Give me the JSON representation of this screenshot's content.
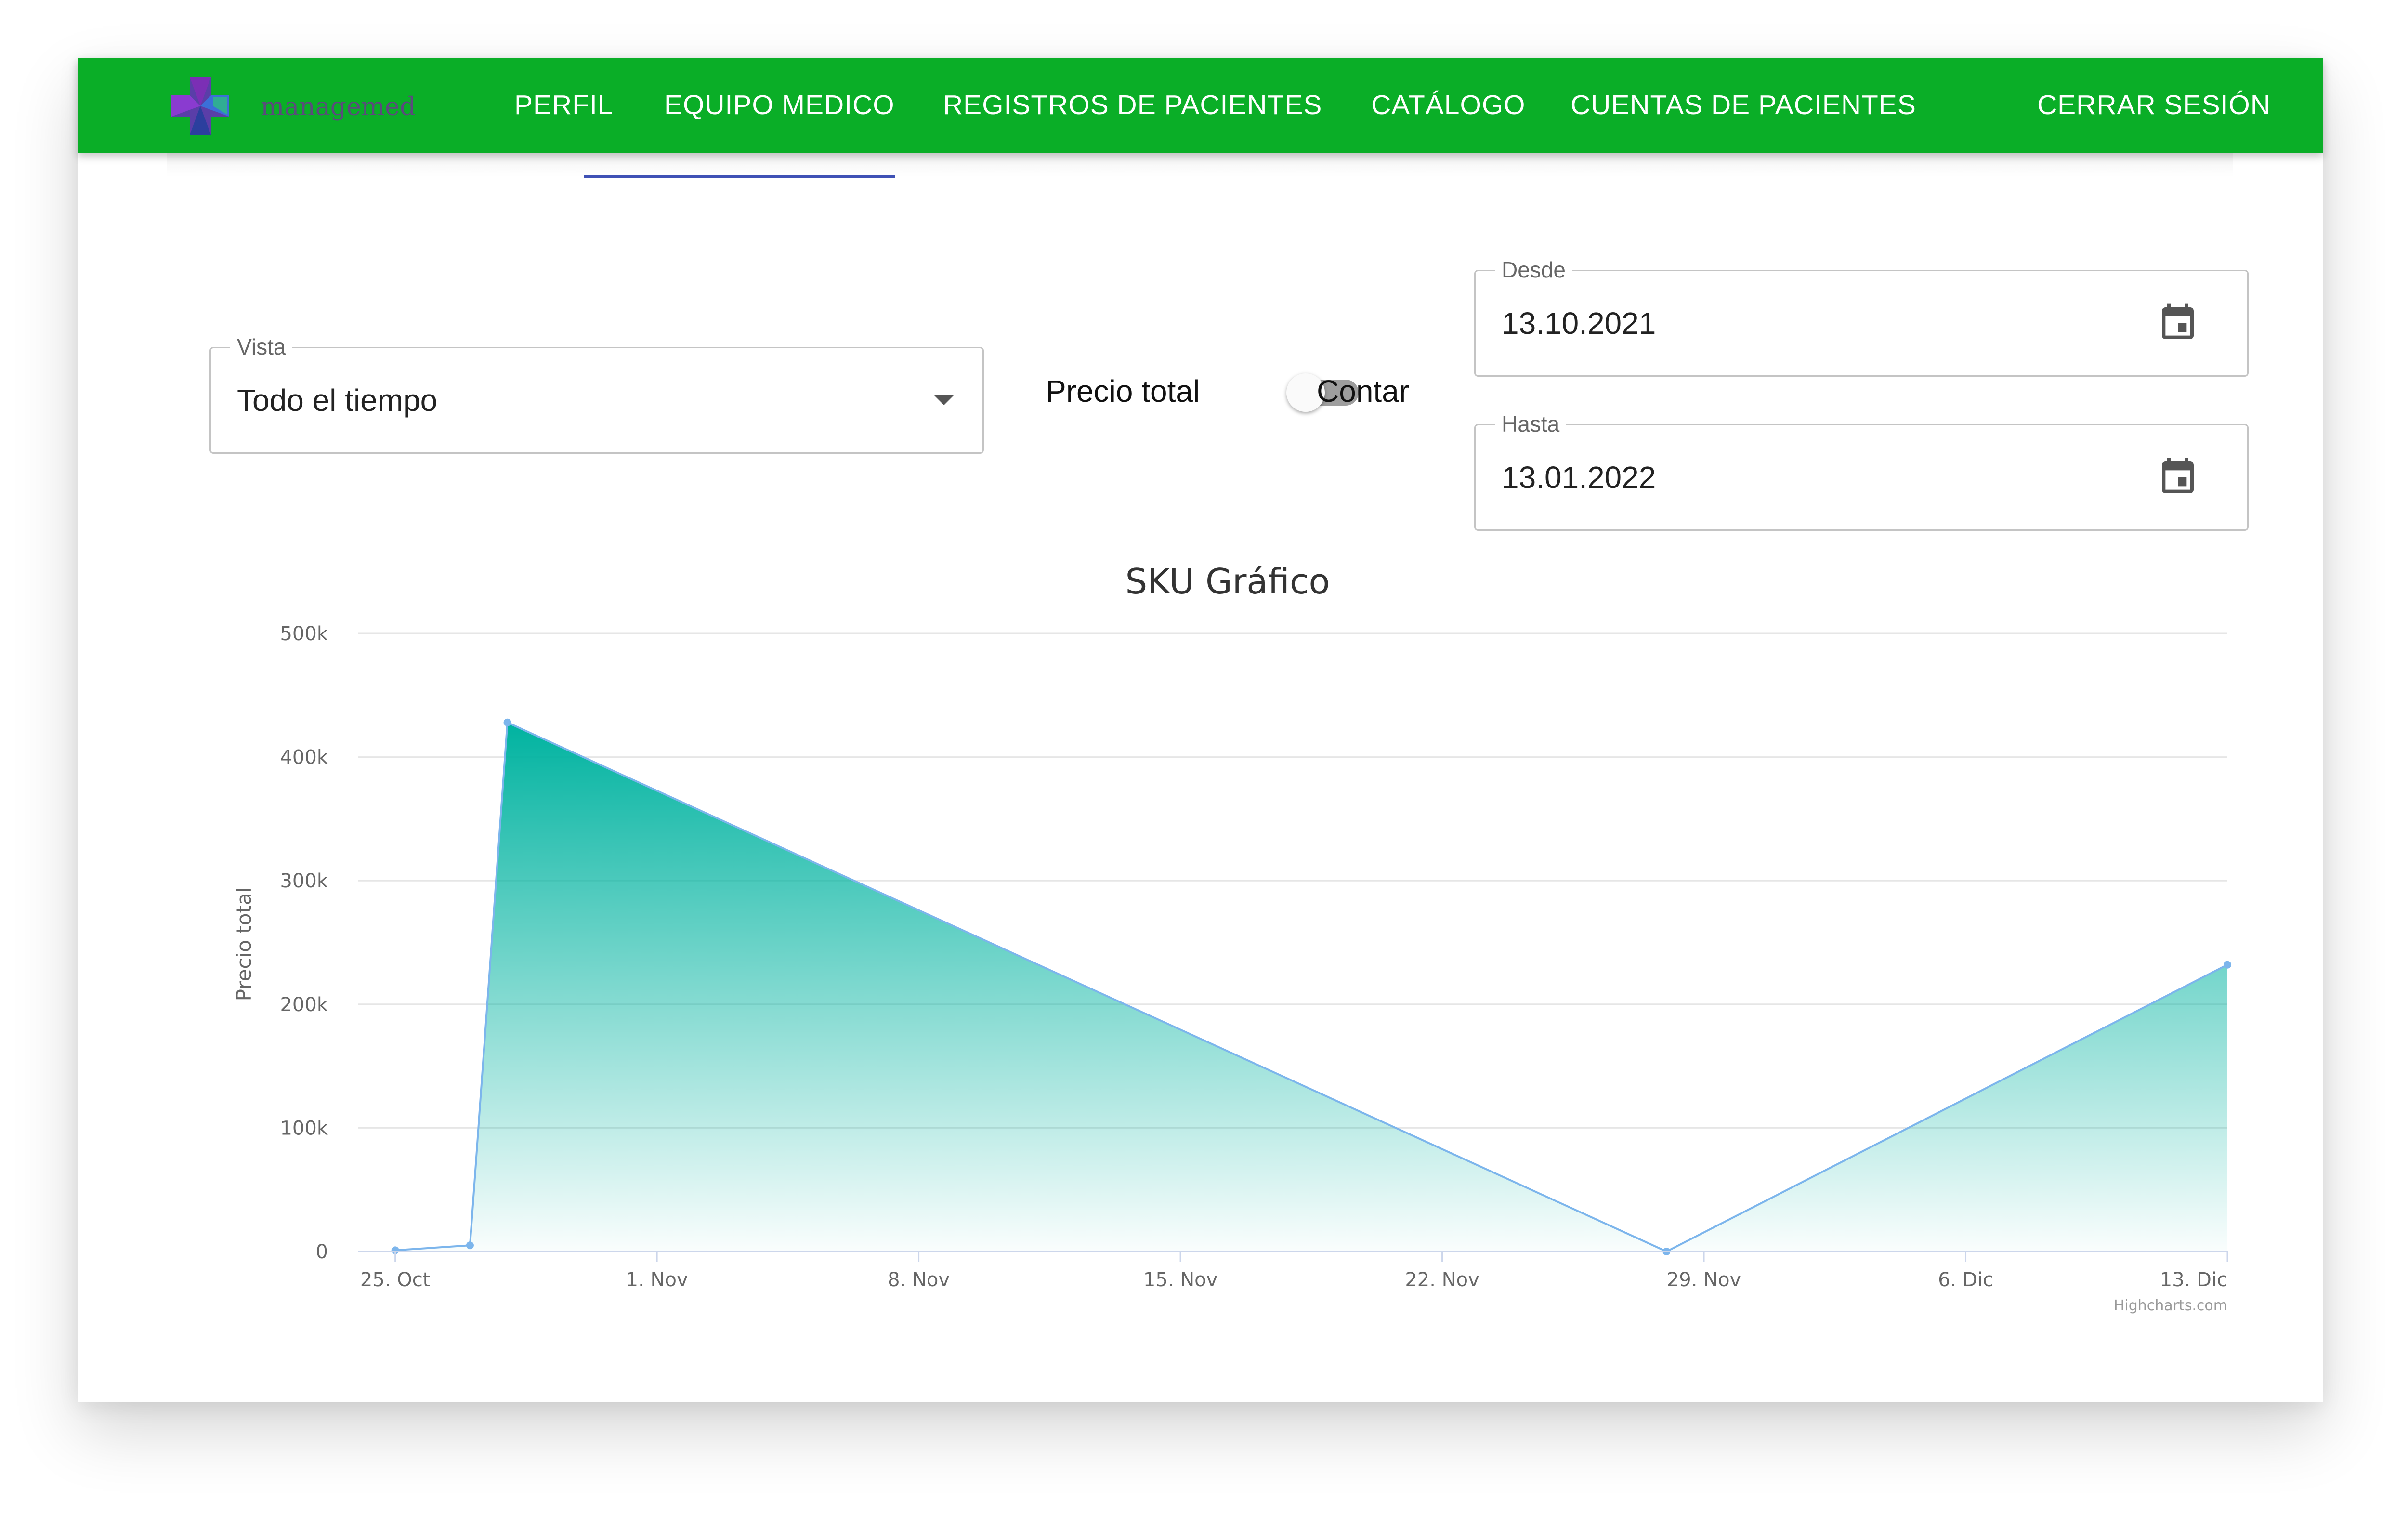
{
  "navbar": {
    "brand": "managemed",
    "items": [
      {
        "label": "PERFIL"
      },
      {
        "label": "EQUIPO MEDICO"
      },
      {
        "label": "REGISTROS DE PACIENTES"
      },
      {
        "label": "CATÁLOGO"
      },
      {
        "label": "CUENTAS DE PACIENTES"
      }
    ],
    "logout": "CERRAR SESIÓN",
    "active_index": 1
  },
  "filters": {
    "view_label": "Vista",
    "view_value": "Todo el tiempo",
    "toggle_left": "Precio total",
    "toggle_right": "Contar",
    "from_label": "Desde",
    "from_value": "13.10.2021",
    "to_label": "Hasta",
    "to_value": "13.01.2022"
  },
  "colors": {
    "navbar": "#0aae27",
    "active_indicator": "#3f51b5",
    "area_top": "#00b3a0",
    "series_line": "#7cb5ec"
  },
  "icons": {
    "calendar": "calendar-icon",
    "dropdown": "arrow-drop-down-icon",
    "logo": "medical-cross-logo-icon"
  },
  "chart_data": {
    "type": "area",
    "title": "SKU Gráfico",
    "ylabel": "Precio total",
    "xlabel": "",
    "credits": "Highcharts.com",
    "x_range": [
      "2021-10-24",
      "2021-12-13"
    ],
    "ylim": [
      0,
      500000
    ],
    "y_ticks": [
      {
        "value": 0,
        "label": "0"
      },
      {
        "value": 100000,
        "label": "100k"
      },
      {
        "value": 200000,
        "label": "200k"
      },
      {
        "value": 300000,
        "label": "300k"
      },
      {
        "value": 400000,
        "label": "400k"
      },
      {
        "value": 500000,
        "label": "500k"
      }
    ],
    "x_ticks": [
      {
        "date": "2021-10-25",
        "label": "25. Oct"
      },
      {
        "date": "2021-11-01",
        "label": "1. Nov"
      },
      {
        "date": "2021-11-08",
        "label": "8. Nov"
      },
      {
        "date": "2021-11-15",
        "label": "15. Nov"
      },
      {
        "date": "2021-11-22",
        "label": "22. Nov"
      },
      {
        "date": "2021-11-29",
        "label": "29. Nov"
      },
      {
        "date": "2021-12-06",
        "label": "6. Dic"
      },
      {
        "date": "2021-12-13",
        "label": "13. Dic"
      }
    ],
    "grid": true,
    "legend": false,
    "points": [
      {
        "date": "2021-10-25",
        "value": 1000
      },
      {
        "date": "2021-10-27",
        "value": 5000
      },
      {
        "date": "2021-10-28",
        "value": 428000
      },
      {
        "date": "2021-11-28",
        "value": 0
      },
      {
        "date": "2021-12-13",
        "value": 232000
      }
    ]
  }
}
